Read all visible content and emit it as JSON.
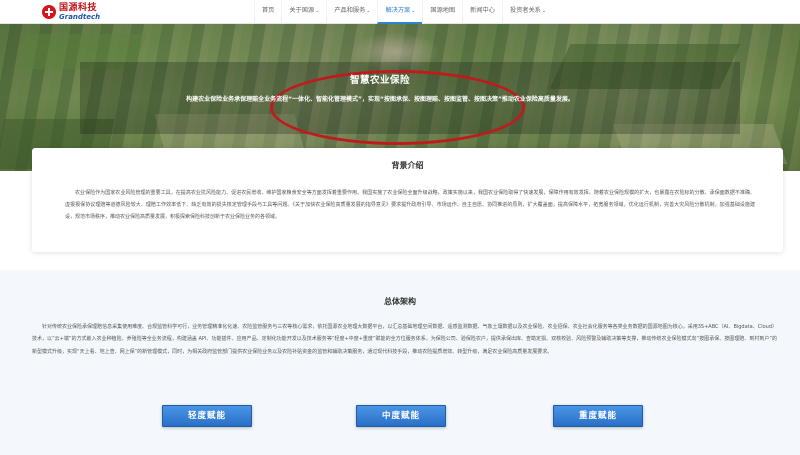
{
  "header": {
    "logo_cn": "国源科技",
    "logo_en": "Grandtech",
    "nav": [
      {
        "label": "首页",
        "dropdown": false,
        "active": false
      },
      {
        "label": "关于国源",
        "dropdown": true,
        "active": false
      },
      {
        "label": "产品和服务",
        "dropdown": true,
        "active": false
      },
      {
        "label": "解决方案",
        "dropdown": true,
        "active": true
      },
      {
        "label": "国源地图",
        "dropdown": false,
        "active": false
      },
      {
        "label": "新闻中心",
        "dropdown": false,
        "active": false
      },
      {
        "label": "投资者关系",
        "dropdown": true,
        "active": false
      }
    ],
    "caret": "⌄"
  },
  "banner": {
    "title": "智慧农业保险",
    "subtitle": "构建农业保险业务承保理赔全业务流程“一体化、智能化管理模式”，实现“按图承保、按图理赔、按图监管、按图决策”推动农业保险高质量发展。"
  },
  "background": {
    "title": "背景介绍",
    "text": "农业保险作为国家农业风险管理的重要工具，在提高农业抗风险能力、促进农民增收、维护国家粮食安全等方面发挥着重要作用。我国实施了农业保险全面升级战略，政策实施以来，我国农业保险取得了快速发展，保障作用有效发挥。随着农业保险规模的扩大，也暴露在农险标的分散、承保面数据不准确、虚报报保协议理赔等道德风险较大、理赔工作效率低下、缺乏有效的损失核定管理手段与工具等问题。《关于加快农业保险高质量发展的指导意见》要求提升政府引导、市场运作、自主自愿、协同推进的原则，扩大覆盖面，提高保障水平，拓宽服务领域，优化运行机制，完善大灾风险分散机制，加强基础设施建设，规范市场秩序，推动农业保险高质量发展，积极探索保险科技创新于农业保险业务的各领域。"
  },
  "architecture": {
    "title": "总体架构",
    "text": "针对传统农业保险承保理赔信息采集使用难度、合规监管科学可行，业务管理精准化化速、农险监管服务与三农等核心需求，依托国源农业地理大数据平台，以汇总基础地理空间数据、遥感监测数据、气象土壤数据以及农业保险、农业招保、农业社会化服务等各类业务数据的国源地图为核心，采用3S+ABC（AI、Bigdata、Cloud）技术，以“云+端”的方式嵌入农业种植险、养殖险等全业务流程，构建涵盖 API、功能插件、应用产品、定制化功能开发以及技术服务等“轻度+中度+重度”赋能的全方位服务体系，为保险公司、验保险农户，提供承保出库、查勘定损、双核校验、风险预警及辅助决策等支撑，推动传统农业保险模式向“按图承保、按图理赔、到村到户”的新型模式升级，实现“天上看、地上查、网上保”的新管理模式，同时，为相关政府监管部门提供农业保险业务以及农险补贴资金的监管和辅助决策服务，通过现代科技手段，推动农险提质增效、转型升级，满足农业保险高质量发展要求。"
  },
  "buttons": {
    "light": "轻度赋能",
    "medium": "中度赋能",
    "heavy": "重度赋能"
  }
}
